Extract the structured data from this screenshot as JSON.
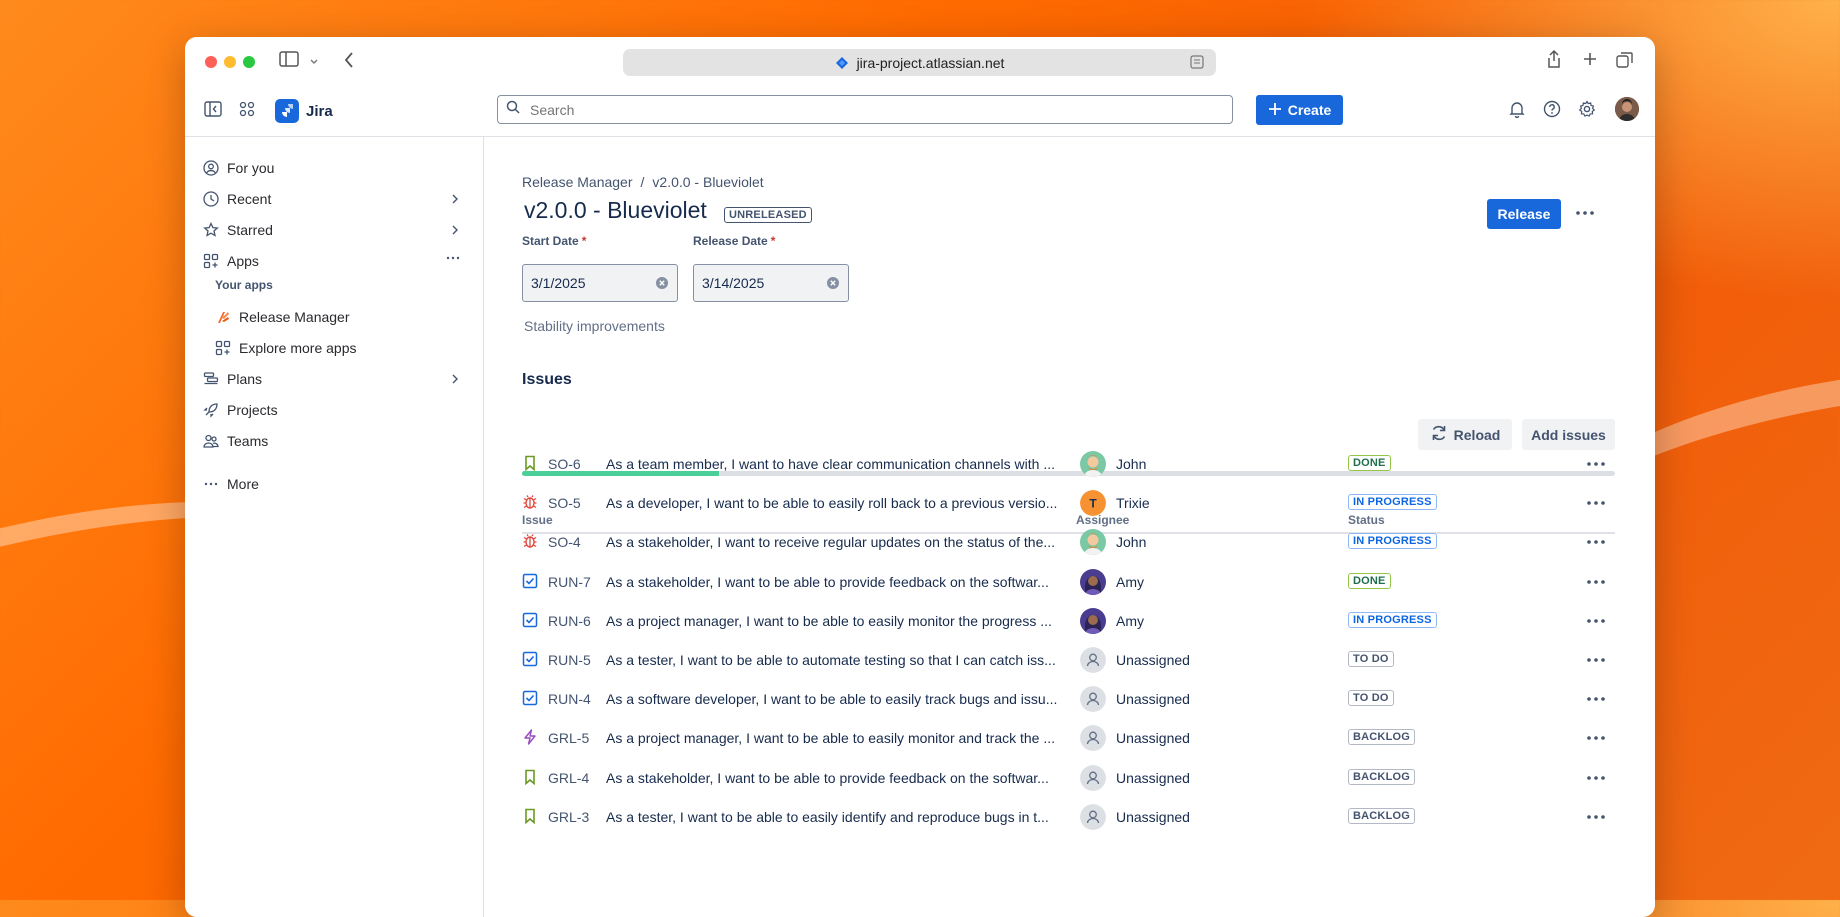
{
  "browser": {
    "url": "jira-project.atlassian.net"
  },
  "app": {
    "name": "Jira",
    "search_placeholder": "Search",
    "create_label": "Create"
  },
  "sidebar": {
    "items": [
      {
        "label": "For you",
        "icon": "person-circle-icon"
      },
      {
        "label": "Recent",
        "icon": "clock-icon"
      },
      {
        "label": "Starred",
        "icon": "star-icon"
      },
      {
        "label": "Apps",
        "icon": "apps-icon"
      },
      {
        "label": "Plans",
        "icon": "plans-icon"
      },
      {
        "label": "Projects",
        "icon": "rocket-icon"
      },
      {
        "label": "Teams",
        "icon": "people-icon"
      },
      {
        "label": "More",
        "icon": "ellipsis-icon"
      }
    ],
    "your_apps_label": "Your apps",
    "apps": [
      {
        "label": "Release Manager",
        "icon": "release-manager-icon"
      },
      {
        "label": "Explore more apps",
        "icon": "grid-plus-icon"
      }
    ]
  },
  "breadcrumb": {
    "parent": "Release Manager",
    "separator": "/",
    "current": "v2.0.0 - Blueviolet"
  },
  "release": {
    "title": "v2.0.0 - Blueviolet",
    "status_lozenge": "UNRELEASED",
    "release_button": "Release",
    "start_date_label": "Start Date",
    "start_date": "3/1/2025",
    "release_date_label": "Release Date",
    "release_date": "3/14/2025",
    "required_marker": "*",
    "description": "Stability improvements"
  },
  "issues": {
    "heading": "Issues",
    "reload_label": "Reload",
    "add_label": "Add issues",
    "progress_done_fraction": 0.18,
    "columns": {
      "issue": "Issue",
      "assignee": "Assignee",
      "status": "Status"
    },
    "rows": [
      {
        "type": "story",
        "key": "SO-6",
        "summary": "As a team member, I want to have clear communication channels with ...",
        "assignee": "John",
        "avatar": "john",
        "status": "DONE",
        "status_kind": "done"
      },
      {
        "type": "bug",
        "key": "SO-5",
        "summary": "As a developer, I want to be able to easily roll back to a previous versio...",
        "assignee": "Trixie",
        "avatar": "trixie",
        "avatar_initial": "T",
        "status": "IN PROGRESS",
        "status_kind": "inprog"
      },
      {
        "type": "bug",
        "key": "SO-4",
        "summary": "As a stakeholder, I want to receive regular updates on the status of the...",
        "assignee": "John",
        "avatar": "john",
        "status": "IN PROGRESS",
        "status_kind": "inprog"
      },
      {
        "type": "task",
        "key": "RUN-7",
        "summary": "As a stakeholder, I want to be able to provide feedback on the softwar...",
        "assignee": "Amy",
        "avatar": "amy",
        "status": "DONE",
        "status_kind": "done"
      },
      {
        "type": "task",
        "key": "RUN-6",
        "summary": "As a project manager, I want to be able to easily monitor the progress ...",
        "assignee": "Amy",
        "avatar": "amy",
        "status": "IN PROGRESS",
        "status_kind": "inprog"
      },
      {
        "type": "task",
        "key": "RUN-5",
        "summary": "As a tester, I want to be able to automate testing so that I can catch iss...",
        "assignee": "Unassigned",
        "avatar": "none",
        "status": "TO DO",
        "status_kind": "todo"
      },
      {
        "type": "task",
        "key": "RUN-4",
        "summary": "As a software developer, I want to be able to easily track bugs and issu...",
        "assignee": "Unassigned",
        "avatar": "none",
        "status": "TO DO",
        "status_kind": "todo"
      },
      {
        "type": "epic",
        "key": "GRL-5",
        "summary": "As a project manager, I want to be able to easily monitor and track the ...",
        "assignee": "Unassigned",
        "avatar": "none",
        "status": "BACKLOG",
        "status_kind": "backlog"
      },
      {
        "type": "story",
        "key": "GRL-4",
        "summary": "As a stakeholder, I want to be able to provide feedback on the softwar...",
        "assignee": "Unassigned",
        "avatar": "none",
        "status": "BACKLOG",
        "status_kind": "backlog"
      },
      {
        "type": "story",
        "key": "GRL-3",
        "summary": "As a tester, I want to be able to easily identify and reproduce bugs in t...",
        "assignee": "Unassigned",
        "avatar": "none",
        "status": "BACKLOG",
        "status_kind": "backlog"
      }
    ]
  },
  "colors": {
    "brand": "#1868db",
    "done_border": "#94c748",
    "inprogress_border": "#8fb8f6",
    "progress_fill": "#4bce97"
  }
}
